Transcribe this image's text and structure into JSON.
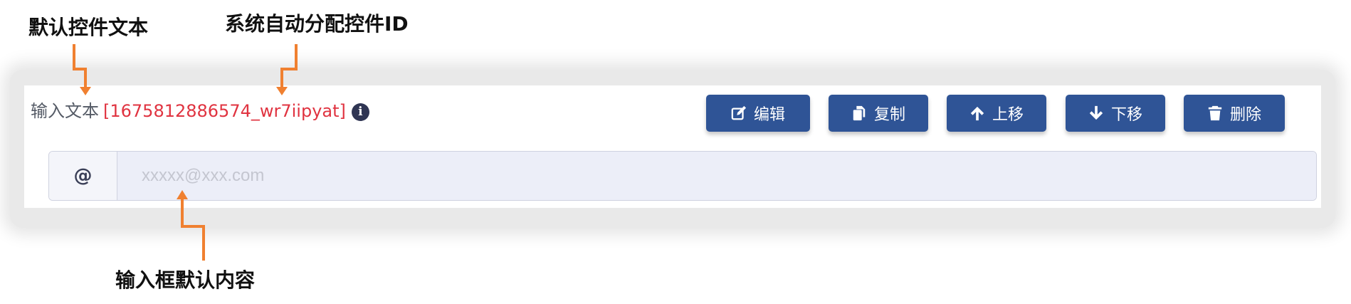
{
  "annotations": {
    "default_text": "默认控件文本",
    "system_id": "系统自动分配控件ID",
    "input_placeholder": "输入框默认内容"
  },
  "field": {
    "label": "输入文本",
    "id": "[1675812886574_wr7iipyat]",
    "info_icon": "info-circle-icon"
  },
  "toolbar": {
    "edit_label": "编辑",
    "copy_label": "复制",
    "move_up_label": "上移",
    "move_down_label": "下移",
    "delete_label": "删除"
  },
  "input": {
    "addon": "@",
    "placeholder": "xxxxx@xxx.com",
    "value": ""
  },
  "colors": {
    "button_bg": "#2f5496",
    "id_text": "#e03340",
    "arrow": "#f08030",
    "input_bg": "#eceef8"
  }
}
